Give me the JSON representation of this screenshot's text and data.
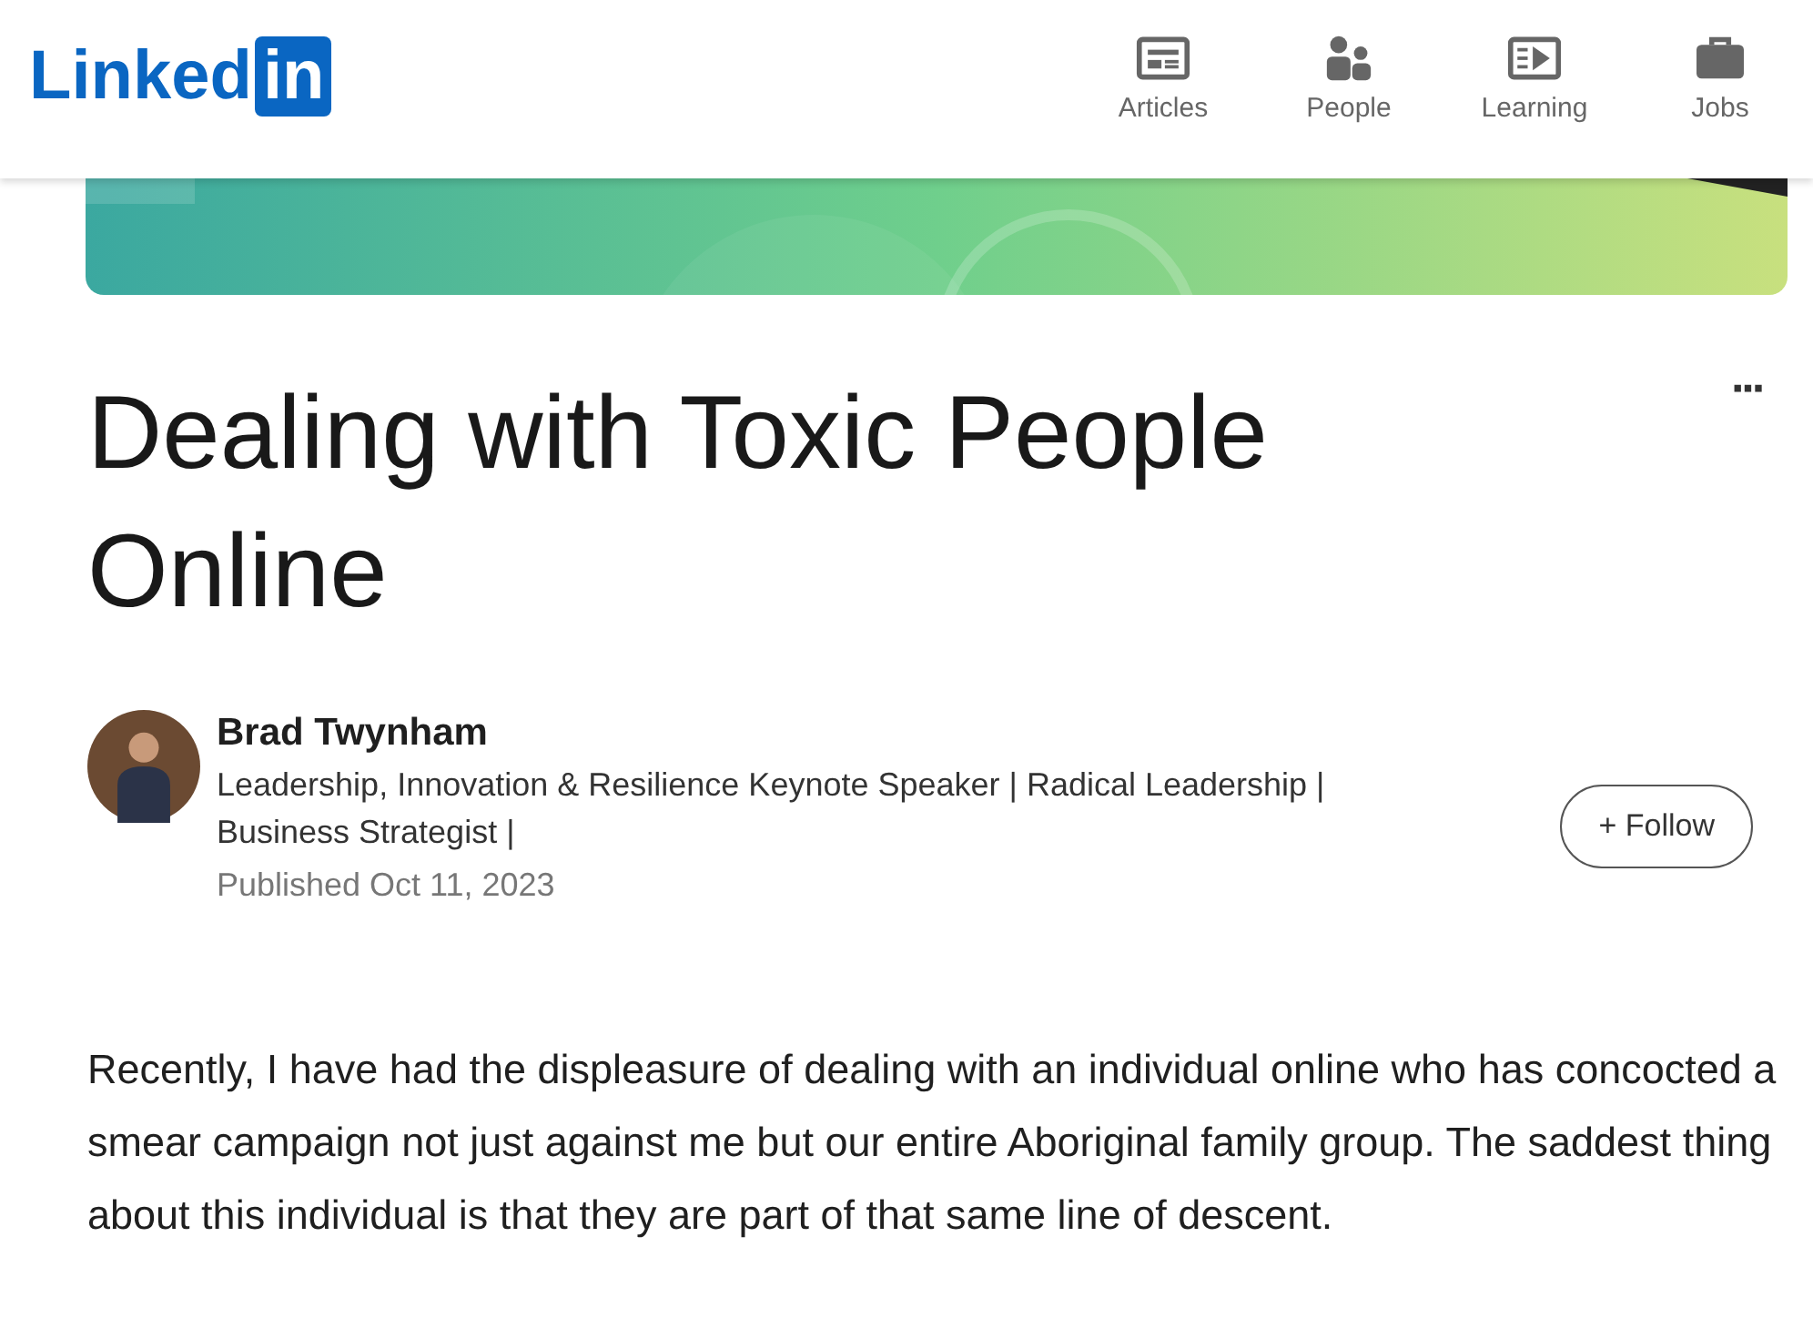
{
  "header": {
    "logo": {
      "word": "Linked",
      "badge": "in"
    },
    "nav": [
      {
        "label": "Articles",
        "kind": "articles"
      },
      {
        "label": "People",
        "kind": "people"
      },
      {
        "label": "Learning",
        "kind": "learning"
      },
      {
        "label": "Jobs",
        "kind": "jobs"
      }
    ]
  },
  "more_menu": "···",
  "article": {
    "title": "Dealing with Toxic People Online",
    "author": {
      "name": "Brad Twynham",
      "headline": "Leadership, Innovation & Resilience Keynote Speaker | Radical Leadership | Business Strategist |",
      "published": "Published Oct 11, 2023"
    },
    "follow_button": "+ Follow",
    "body": "Recently, I have had the displeasure of dealing with an individual online who has concocted a smear campaign not just against me but our entire Aboriginal family group. The saddest thing about this individual is that they are part of that same line of descent."
  }
}
